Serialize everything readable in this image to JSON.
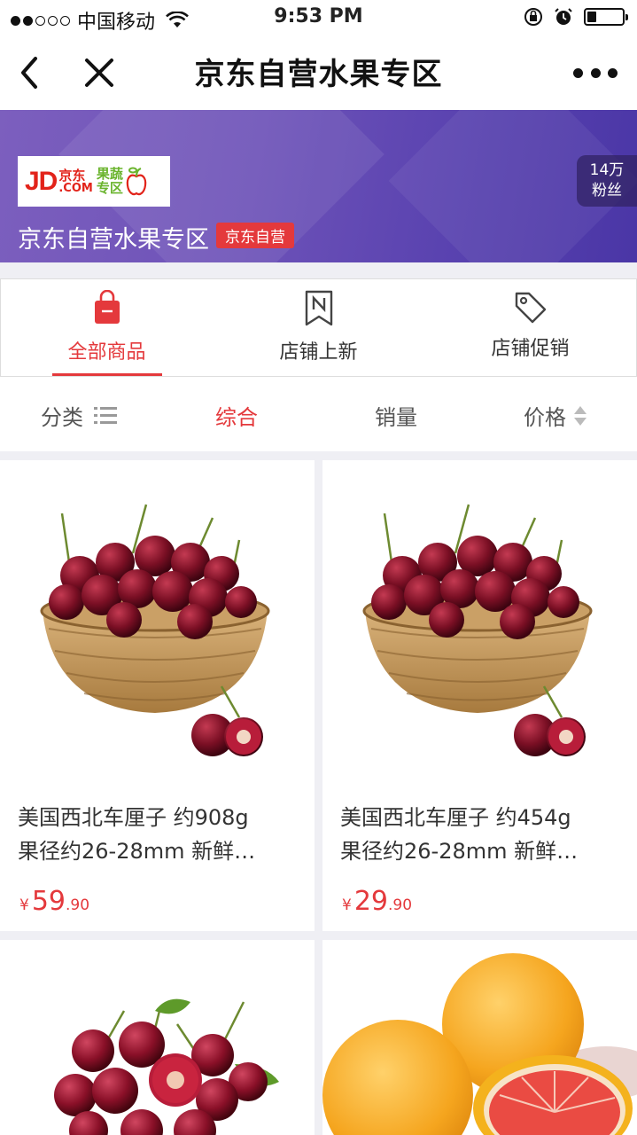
{
  "status_bar": {
    "carrier": "中国移动",
    "time": "9:53 PM"
  },
  "nav": {
    "title": "京东自营水果专区"
  },
  "store": {
    "logo_text": "JD",
    "logo_com": ".COM",
    "logo_cn": "京东",
    "logo_sub1": "果蔬",
    "logo_sub2": "专区",
    "name": "京东自营水果专区",
    "badge": "京东自营",
    "fans_count": "14万",
    "fans_label": "粉丝"
  },
  "tabs": [
    {
      "label": "全部商品",
      "icon": "shopping-bag-icon",
      "active": true
    },
    {
      "label": "店铺上新",
      "icon": "new-bookmark-icon",
      "active": false
    },
    {
      "label": "店铺促销",
      "icon": "price-tag-icon",
      "active": false
    }
  ],
  "sort": {
    "category": "分类",
    "overall": "综合",
    "sales": "销量",
    "price": "价格"
  },
  "products": [
    {
      "title_line1": "美国西北车厘子 约908g",
      "title_line2": "果径约26-28mm 新鲜…",
      "currency": "¥",
      "price_int": "59",
      "price_dec": ".90",
      "image": "cherries-basket"
    },
    {
      "title_line1": "美国西北车厘子 约454g",
      "title_line2": "果径约26-28mm 新鲜…",
      "currency": "¥",
      "price_int": "29",
      "price_dec": ".90",
      "image": "cherries-basket"
    },
    {
      "image": "cherries-with-leaves"
    },
    {
      "image": "grapefruits"
    }
  ],
  "colors": {
    "accent": "#e4393c",
    "banner_purple": "#6d52b8"
  }
}
